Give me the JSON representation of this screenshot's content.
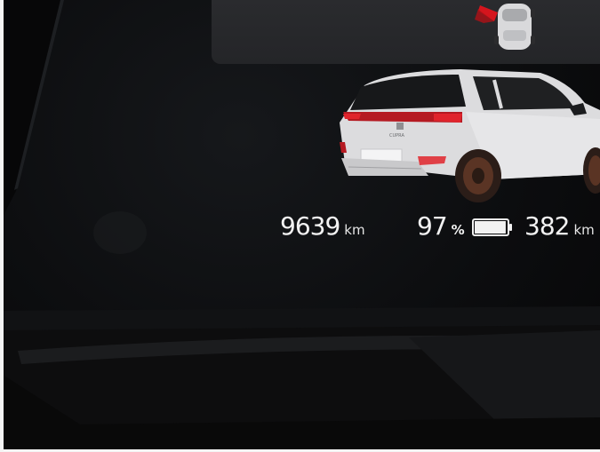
{
  "cluster": {
    "odometer": {
      "value": "9639",
      "unit": "km"
    },
    "battery": {
      "percent": "97",
      "percent_unit": "%",
      "level": 0.97,
      "icon": "battery-icon"
    },
    "range": {
      "value": "382",
      "unit": "km"
    }
  },
  "vehicle": {
    "icon": "car-rear-view-image",
    "badge_text": "CUPRA",
    "color": "#e9e9ea",
    "light_color": "#e0242c"
  },
  "top_card": {
    "icon": "parked-car-top-view-icon",
    "door_indicator_color": "#d4151d"
  },
  "colors": {
    "text": "#f2f2f2",
    "background": "#0c0d0f",
    "card": "#27282b"
  }
}
